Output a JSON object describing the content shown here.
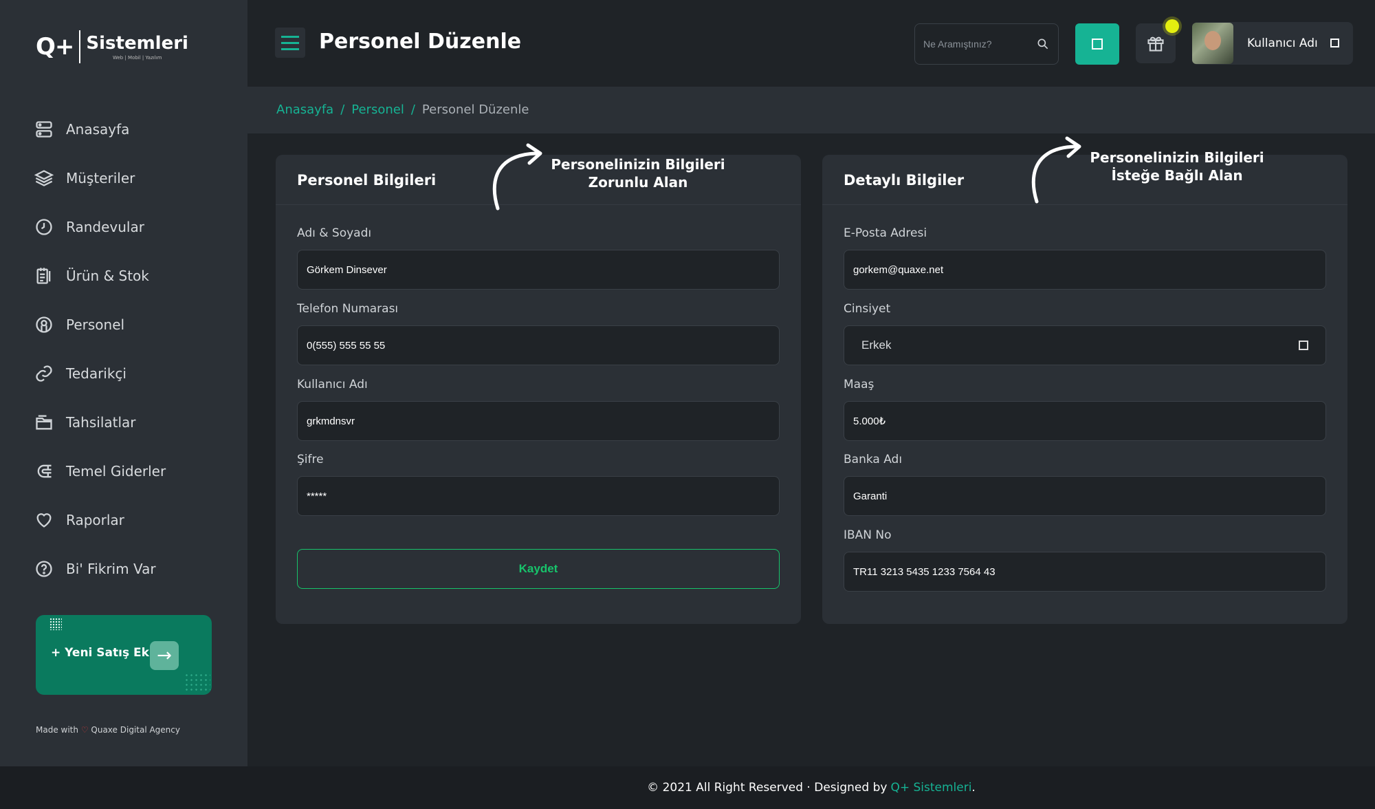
{
  "logo": {
    "mark": "Q+",
    "name": "Sistemleri",
    "sub": "Web | Mobil | Yazılım"
  },
  "sidebar": {
    "items": [
      {
        "label": "Anasayfa",
        "icon": "dashboard-icon"
      },
      {
        "label": "Müşteriler",
        "icon": "layers-icon"
      },
      {
        "label": "Randevular",
        "icon": "clock-icon"
      },
      {
        "label": "Ürün & Stok",
        "icon": "clipboard-icon"
      },
      {
        "label": "Personel",
        "icon": "user-circle-icon"
      },
      {
        "label": "Tedarikçi",
        "icon": "link-icon"
      },
      {
        "label": "Tahsilatlar",
        "icon": "folder-icon"
      },
      {
        "label": "Temel Giderler",
        "icon": "magnet-icon"
      },
      {
        "label": "Raporlar",
        "icon": "heart-icon"
      },
      {
        "label": "Bi' Fikrim Var",
        "icon": "help-circle-icon"
      }
    ],
    "promo_label": "+ Yeni Satış Ekle",
    "made_with_prefix": "Made with",
    "made_with_heart": "♡",
    "made_with_suffix": "Quaxe Digital Agency"
  },
  "header": {
    "title": "Personel Düzenle",
    "search_placeholder": "Ne Aramıştınız?",
    "user_name": "Kullanıcı Adı"
  },
  "breadcrumb": {
    "home": "Anasayfa",
    "section": "Personel",
    "current": "Personel Düzenle",
    "sep": "/"
  },
  "personal_card": {
    "title": "Personel Bilgileri",
    "note": "Personelinizin Bilgileri\nZorunlu Alan",
    "fields": [
      {
        "label": "Adı & Soyadı",
        "value": "Görkem Dinsever"
      },
      {
        "label": "Telefon Numarası",
        "value": "0(555) 555 55 55"
      },
      {
        "label": "Kullanıcı Adı",
        "value": "grkmdnsvr"
      },
      {
        "label": "Şifre",
        "value": "*****"
      }
    ],
    "save_label": "Kaydet"
  },
  "detail_card": {
    "title": "Detaylı Bilgiler",
    "note": "Personelinizin Bilgileri\nİsteğe Bağlı Alan",
    "fields": [
      {
        "label": "E-Posta Adresi",
        "value": "gorkem@quaxe.net"
      },
      {
        "label": "Cinsiyet",
        "value": "Erkek"
      },
      {
        "label": "Maaş",
        "value": "5.000₺"
      },
      {
        "label": "Banka Adı",
        "value": "Garanti"
      },
      {
        "label": "IBAN No",
        "value": "TR11 3213 5435 1233 7564 43"
      }
    ]
  },
  "footer": {
    "text": "© 2021 All Right Reserved · Designed by",
    "brand": "Q+ Sistemleri",
    "end": "."
  },
  "colors": {
    "accent": "#16b394",
    "save": "#17c46b",
    "promo": "#0a7a5e",
    "notification": "#e4ef10"
  }
}
